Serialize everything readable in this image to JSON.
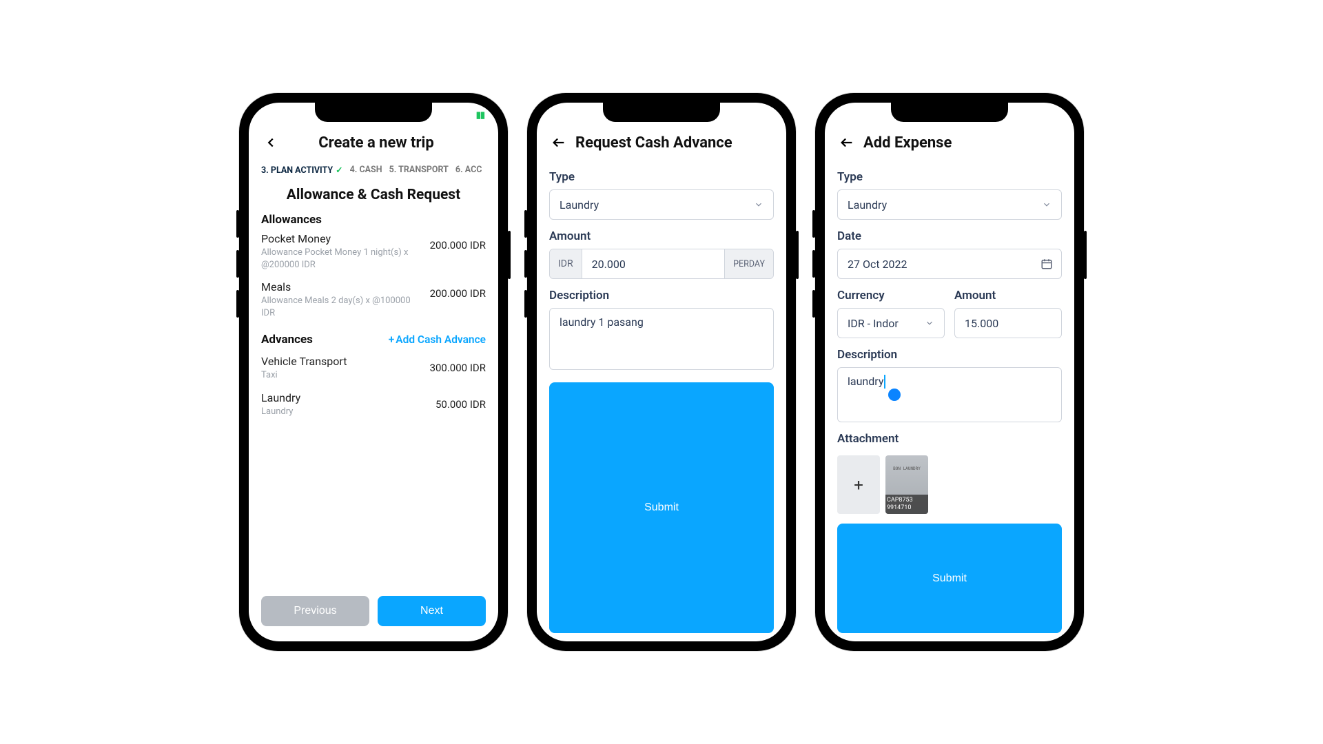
{
  "screen1": {
    "title": "Create a new trip",
    "steps": {
      "s3": "3. PLAN ACTIVITY",
      "s4": "4. CASH",
      "s5": "5. TRANSPORT",
      "s6": "6. ACC"
    },
    "section_title": "Allowance & Cash Request",
    "allowances_header": "Allowances",
    "allowances": [
      {
        "title": "Pocket Money",
        "desc": "Allowance Pocket Money 1 night(s) x @200000 IDR",
        "amount": "200.000 IDR"
      },
      {
        "title": "Meals",
        "desc": "Allowance Meals 2 day(s) x @100000 IDR",
        "amount": "200.000 IDR"
      }
    ],
    "advances_header": "Advances",
    "add_advance_label": "Add Cash Advance",
    "advances": [
      {
        "title": "Vehicle Transport",
        "desc": "Taxi",
        "amount": "300.000 IDR"
      },
      {
        "title": "Laundry",
        "desc": "Laundry",
        "amount": "50.000 IDR"
      }
    ],
    "prev_btn": "Previous",
    "next_btn": "Next"
  },
  "screen2": {
    "title": "Request Cash Advance",
    "type_label": "Type",
    "type_value": "Laundry",
    "amount_label": "Amount",
    "amount_currency": "IDR",
    "amount_value": "20.000",
    "amount_unit": "PERDAY",
    "description_label": "Description",
    "description_value": "laundry 1 pasang",
    "submit": "Submit"
  },
  "screen3": {
    "title": "Add Expense",
    "type_label": "Type",
    "type_value": "Laundry",
    "date_label": "Date",
    "date_value": "27 Oct 2022",
    "currency_label": "Currency",
    "currency_value": "IDR - Indor",
    "amount_label": "Amount",
    "amount_value": "15.000",
    "description_label": "Description",
    "description_value": "laundry",
    "attachment_label": "Attachment",
    "attachment_id": "CAP8753 9914710",
    "attachment_receipt": "BON LAUNDRY",
    "submit": "Submit"
  }
}
